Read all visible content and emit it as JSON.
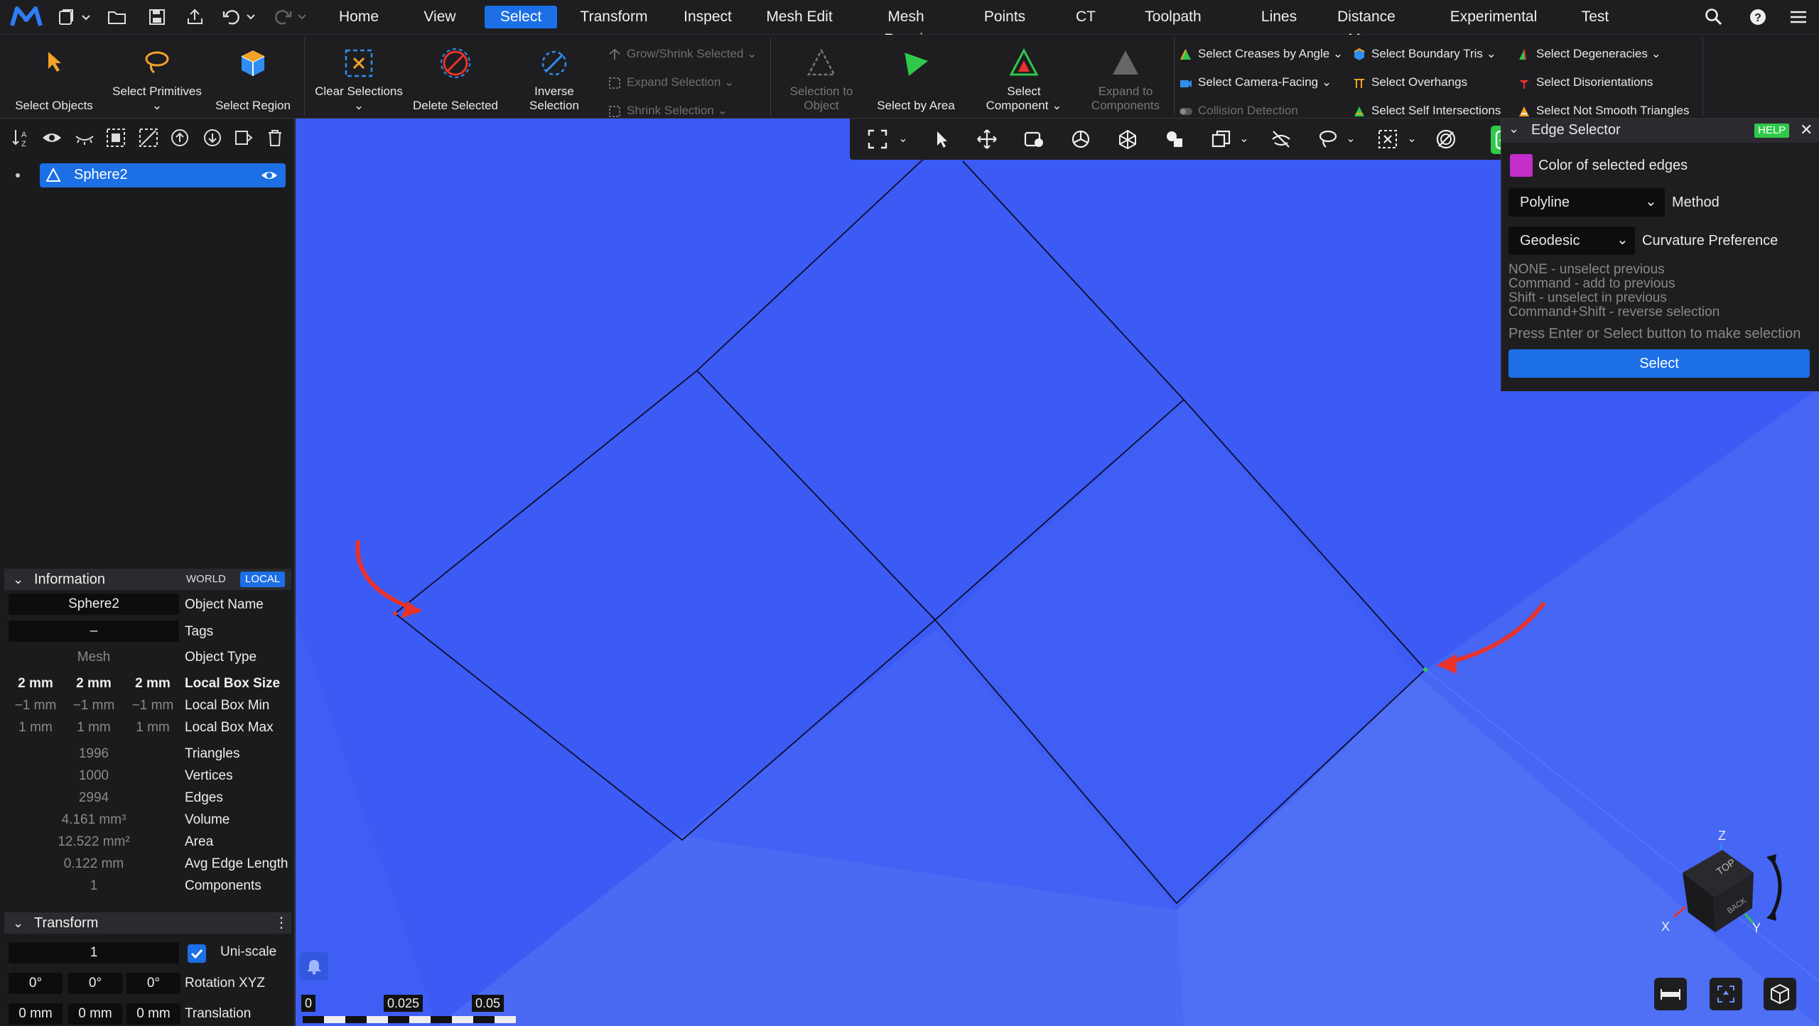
{
  "menubar": {
    "tabs": [
      "Home",
      "View",
      "Select",
      "Transform",
      "Inspect",
      "Mesh Edit",
      "Mesh Repair",
      "Points",
      "CT",
      "Toolpath",
      "Lines",
      "Distance Maps",
      "Experimental",
      "Test"
    ],
    "active_tab": "Select"
  },
  "ribbon": {
    "select_objects": "Select Objects",
    "select_primitives": "Select Primitives",
    "select_region": "Select Region",
    "clear_selections": "Clear Selections",
    "delete_selected": "Delete Selected",
    "inverse_selection": "Inverse Selection",
    "grow_shrink": "Grow/Shrink Selected",
    "expand_selection": "Expand Selection",
    "shrink_selection": "Shrink Selection",
    "selection_to_object": "Selection to Object",
    "select_by_area": "Select by Area",
    "select_component": "Select Component",
    "expand_to_components": "Expand to Components",
    "creases": "Select Creases by Angle",
    "camera_facing": "Select Camera-Facing",
    "collision": "Collision Detection",
    "boundary_tris": "Select Boundary Tris",
    "overhangs": "Select Overhangs",
    "self_intersections": "Select Self Intersections",
    "degeneracies": "Select Degeneracies",
    "disorientations": "Select Disorientations",
    "not_smooth": "Select Not Smooth Triangles"
  },
  "scene_tree": {
    "object_name": "Sphere2"
  },
  "information": {
    "title": "Information",
    "world": "WORLD",
    "local": "LOCAL",
    "object_name_value": "Sphere2",
    "object_name_label": "Object Name",
    "tags_value": "–",
    "tags_label": "Tags",
    "type_value": "Mesh",
    "type_label": "Object Type",
    "box_size": [
      "2 mm",
      "2 mm",
      "2 mm"
    ],
    "box_size_label": "Local Box Size",
    "box_min": [
      "−1 mm",
      "−1 mm",
      "−1 mm"
    ],
    "box_min_label": "Local Box Min",
    "box_max": [
      "1 mm",
      "1 mm",
      "1 mm"
    ],
    "box_max_label": "Local Box Max",
    "triangles": "1996",
    "triangles_label": "Triangles",
    "vertices": "1000",
    "vertices_label": "Vertices",
    "edges": "2994",
    "edges_label": "Edges",
    "volume": "4.161 mm³",
    "volume_label": "Volume",
    "area": "12.522 mm²",
    "area_label": "Area",
    "avg_edge": "0.122 mm",
    "avg_edge_label": "Avg Edge Length",
    "components": "1",
    "components_label": "Components"
  },
  "transform": {
    "title": "Transform",
    "scale": "1",
    "uniscale_label": "Uni-scale",
    "rotation": [
      "0°",
      "0°",
      "0°"
    ],
    "rotation_label": "Rotation XYZ",
    "translation": [
      "0 mm",
      "0 mm",
      "0 mm"
    ],
    "translation_label": "Translation"
  },
  "edge_selector": {
    "title": "Edge Selector",
    "help": "HELP",
    "color_label": "Color of selected edges",
    "color": "#c32ec8",
    "method_value": "Polyline",
    "method_label": "Method",
    "curvature_value": "Geodesic",
    "curvature_label": "Curvature Preference",
    "hint1": "NONE - unselect previous",
    "hint2": "Command - add to previous",
    "hint3": "Shift - unselect in previous",
    "hint4": "Command+Shift - reverse selection",
    "hint5": "Press Enter or Select button to make selection",
    "select_button": "Select"
  },
  "scale_bar": {
    "labels": [
      "0",
      "0.025",
      "0.05"
    ]
  },
  "gizmo": {
    "axis_z": "Z",
    "axis_x": "X",
    "axis_y": "Y",
    "face_top": "TOP",
    "face_back": "BACK"
  },
  "colors": {
    "accent": "#1c6fe5",
    "scene_bg": "#3b5bf4",
    "annotation_arrow": "#e8322a"
  }
}
